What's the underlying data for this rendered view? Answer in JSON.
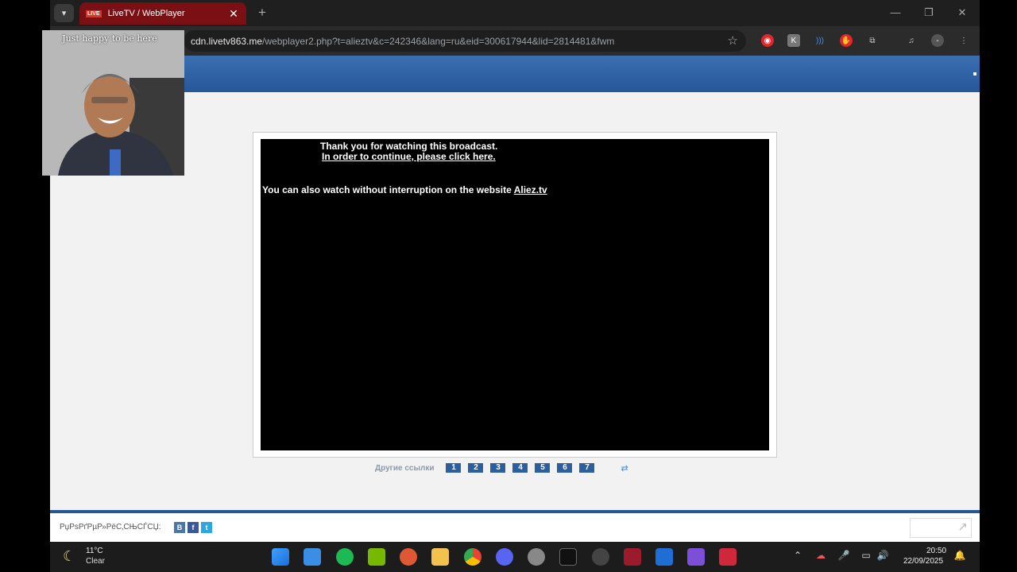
{
  "browser": {
    "tab": {
      "badge": "LIVE",
      "title": "LiveTV / WebPlayer"
    },
    "new_tab_label": "+",
    "url": {
      "host": "cdn.livetv863.me",
      "path": "/webplayer2.php?t=alieztv&c=242346&lang=ru&eid=300617944&lid=2814481&fwm"
    }
  },
  "page": {
    "player": {
      "line1": "Thank you for watching this broadcast.",
      "line2": "In order to continue, please click here.",
      "line3_prefix": "You can also watch without interruption on the website ",
      "line3_link": "Aliez.tv"
    },
    "other_links": {
      "label": "Другие ссылки",
      "items": [
        "1",
        "2",
        "3",
        "4",
        "5",
        "6",
        "7"
      ]
    },
    "footer": {
      "share_text": "РџРѕРґРµР»РёС‚СЊСЃСЏ:",
      "social": [
        "В",
        "f",
        "t"
      ]
    }
  },
  "webcam": {
    "caption": "Just happy to be here"
  },
  "taskbar": {
    "weather": {
      "temp": "11°C",
      "condition": "Clear"
    },
    "clock": {
      "time": "20:50",
      "date": "22/09/2025"
    }
  },
  "colors": {
    "accent_blue": "#26569a",
    "tab_red": "#7a0f14",
    "link_blue": "#2c5f9e"
  }
}
